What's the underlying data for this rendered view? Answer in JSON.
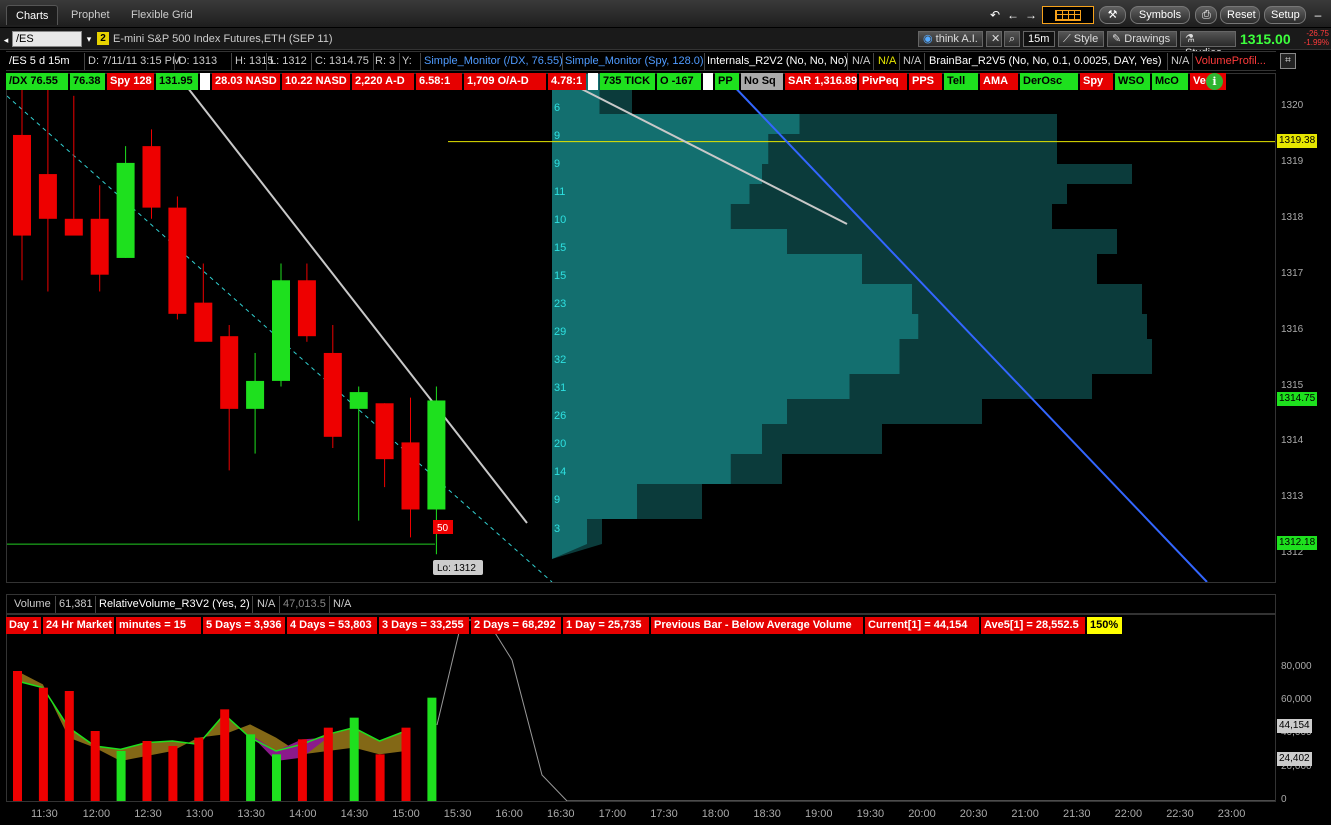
{
  "tabs": {
    "charts": "Charts",
    "prophet": "Prophet",
    "flexible_grid": "Flexible Grid"
  },
  "toolbar": {
    "symbols": "Symbols",
    "reset": "Reset",
    "setup": "Setup"
  },
  "chartbar": {
    "symbol": "/ES",
    "link": "2",
    "description": "E-mini S&P 500 Index Futures,ETH (SEP 11)",
    "think_ai": "think A.I.",
    "timeframe": "15m",
    "style": "Style",
    "drawings": "Drawings",
    "studies": "Studies",
    "last_price": "1315.00",
    "change_1": "-26.75",
    "change_2": "-1.99%"
  },
  "inforow": {
    "period": "/ES 5 d 15m",
    "date": "D: 7/11/11 3:15 PM",
    "open": "O: 1313",
    "high": "H: 1315",
    "low": "L: 1312",
    "close": "C: 1314.75",
    "range": "R: 3",
    "y": "Y:",
    "mon1": "Simple_Monitor (/DX, 76.55)",
    "mon2": "Simple_Monitor (Spy, 128.0)",
    "internals": "Internals_R2V2 (No, No, No)",
    "na1": "N/A",
    "na2": "N/A",
    "na3": "N/A",
    "brainbar": "BrainBar_R2V5 (No, No, 0.1, 0.0025, DAY, Yes)",
    "na4": "N/A",
    "vprofile": "VolumeProfil..."
  },
  "labels": [
    {
      "text": "/DX 76.55",
      "c": "g"
    },
    {
      "text": "76.38",
      "c": "g"
    },
    {
      "text": "Spy 128",
      "c": "r"
    },
    {
      "text": "131.95",
      "c": "g"
    },
    {
      "text": "",
      "c": "w"
    },
    {
      "text": "28.03 NASD",
      "c": "r"
    },
    {
      "text": "10.22 NASD",
      "c": "r"
    },
    {
      "text": "2,220 A-D",
      "c": "r"
    },
    {
      "text": "6.58:1",
      "c": "r"
    },
    {
      "text": "1,709 O/A-D",
      "c": "r"
    },
    {
      "text": "4.78:1",
      "c": "r"
    },
    {
      "text": "",
      "c": "w"
    },
    {
      "text": "735 TICK",
      "c": "g"
    },
    {
      "text": "O -167",
      "c": "g"
    },
    {
      "text": "",
      "c": "w"
    },
    {
      "text": "PP",
      "c": "g"
    },
    {
      "text": "No Sq",
      "c": "gr"
    },
    {
      "text": "SAR 1,316.89",
      "c": "r"
    },
    {
      "text": "PivPeq",
      "c": "r"
    },
    {
      "text": "PPS",
      "c": "r"
    },
    {
      "text": "Tell",
      "c": "g"
    },
    {
      "text": "AMA",
      "c": "r"
    },
    {
      "text": "DerOsc",
      "c": "g"
    },
    {
      "text": "Spy",
      "c": "r"
    },
    {
      "text": "WSO",
      "c": "g"
    },
    {
      "text": "McO",
      "c": "g"
    },
    {
      "text": "Verv",
      "c": "r"
    }
  ],
  "price_axis": {
    "ticks": [
      "1320",
      "1319",
      "1318",
      "1317",
      "1316",
      "1315",
      "1314",
      "1313",
      "1312"
    ],
    "box_yellow": "1319.38",
    "box_green1": "1314.75",
    "box_green2": "1312.18"
  },
  "profile_counts": [
    "6",
    "9",
    "9",
    "11",
    "10",
    "15",
    "15",
    "23",
    "29",
    "32",
    "31",
    "26",
    "20",
    "14",
    "9",
    "3"
  ],
  "candle_labels": {
    "red_tag": "50",
    "low_tag": "Lo: 1312"
  },
  "volume": {
    "label": "Volume",
    "value": "61,381",
    "study": "RelativeVolume_R3V2 (Yes, 2)",
    "na1": "N/A",
    "value2": "47,013.5",
    "na2": "N/A",
    "labels": [
      {
        "text": "Day 1",
        "c": "r"
      },
      {
        "text": "24 Hr Market",
        "c": "r"
      },
      {
        "text": "minutes = 15",
        "c": "r"
      },
      {
        "text": "5 Days = 3,936",
        "c": "r"
      },
      {
        "text": "4 Days = 53,803",
        "c": "r"
      },
      {
        "text": "3 Days = 33,255",
        "c": "r"
      },
      {
        "text": "2 Days = 68,292",
        "c": "r"
      },
      {
        "text": "1 Day = 25,735",
        "c": "r"
      },
      {
        "text": "Previous Bar - Below Average Volume",
        "c": "r"
      },
      {
        "text": "Current[1] = 44,154",
        "c": "r"
      },
      {
        "text": "Ave5[1] = 28,552.5",
        "c": "r"
      },
      {
        "text": "150%",
        "c": "y"
      }
    ],
    "axis_ticks": [
      "80,000",
      "60,000",
      "40,000",
      "20,000",
      "0"
    ],
    "box1": "44,154",
    "box2": "24,402"
  },
  "time_axis": [
    "11:30",
    "12:00",
    "12:30",
    "13:00",
    "13:30",
    "14:00",
    "14:30",
    "15:00",
    "15:30",
    "16:00",
    "16:30",
    "17:00",
    "17:30",
    "18:00",
    "18:30",
    "19:00",
    "19:30",
    "20:00",
    "20:30",
    "21:00",
    "21:30",
    "22:00",
    "22:30",
    "23:00"
  ],
  "chart_data": {
    "type": "candlestick",
    "candles": [
      {
        "o": 1319.5,
        "h": 1320.4,
        "l": 1316.9,
        "c": 1317.7
      },
      {
        "o": 1318.8,
        "h": 1320.6,
        "l": 1316.7,
        "c": 1318.0
      },
      {
        "o": 1318.0,
        "h": 1320.2,
        "l": 1318.0,
        "c": 1317.7
      },
      {
        "o": 1318.0,
        "h": 1318.6,
        "l": 1316.7,
        "c": 1317.0
      },
      {
        "o": 1317.3,
        "h": 1319.3,
        "l": 1317.3,
        "c": 1319.0
      },
      {
        "o": 1319.3,
        "h": 1319.6,
        "l": 1318.0,
        "c": 1318.2
      },
      {
        "o": 1318.2,
        "h": 1318.4,
        "l": 1316.2,
        "c": 1316.3
      },
      {
        "o": 1316.5,
        "h": 1317.2,
        "l": 1315.9,
        "c": 1315.8
      },
      {
        "o": 1315.9,
        "h": 1316.1,
        "l": 1313.5,
        "c": 1314.6
      },
      {
        "o": 1314.6,
        "h": 1315.6,
        "l": 1313.8,
        "c": 1315.1
      },
      {
        "o": 1315.1,
        "h": 1317.2,
        "l": 1315.0,
        "c": 1316.9
      },
      {
        "o": 1316.9,
        "h": 1317.2,
        "l": 1315.8,
        "c": 1315.9
      },
      {
        "o": 1315.6,
        "h": 1316.1,
        "l": 1313.9,
        "c": 1314.1
      },
      {
        "o": 1314.6,
        "h": 1315.0,
        "l": 1312.6,
        "c": 1314.9
      },
      {
        "o": 1314.7,
        "h": 1314.7,
        "l": 1313.2,
        "c": 1313.7
      },
      {
        "o": 1314.0,
        "h": 1314.8,
        "l": 1312.3,
        "c": 1312.8
      },
      {
        "o": 1312.8,
        "h": 1315.0,
        "l": 1312.0,
        "c": 1314.75
      }
    ],
    "volumes": [
      78000,
      68000,
      66000,
      42000,
      30000,
      36000,
      33000,
      38000,
      55000,
      40000,
      28000,
      37000,
      44000,
      50000,
      28000,
      44000,
      62000
    ],
    "ylim": [
      1311.7,
      1320.8
    ],
    "vol_ylim": [
      0,
      95000
    ]
  }
}
